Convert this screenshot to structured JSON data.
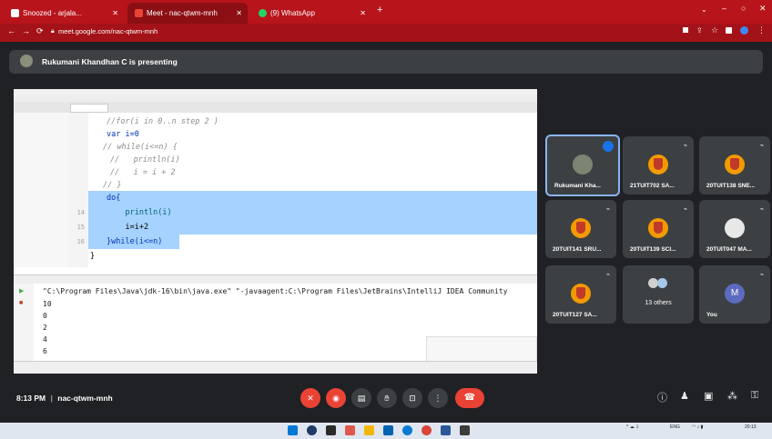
{
  "tabs": [
    {
      "label": "Snoozed - arjala...",
      "color": "#ffffff"
    },
    {
      "label": "Meet - nac-qtwm-mnh",
      "color": "#ea4335"
    },
    {
      "label": "(9) WhatsApp",
      "color": "#25d366"
    }
  ],
  "address": {
    "url": "meet.google.com/nac-qtwm-mnh"
  },
  "presenting": {
    "text": "Rukumani Khandhan C is presenting"
  },
  "code": {
    "lines": [
      {
        "num": "",
        "text": "//for(i in 0..n step 2 )",
        "style": "cmt",
        "selected": false
      },
      {
        "num": "",
        "text": "var i=0",
        "style": "kw",
        "selected": false
      },
      {
        "num": "",
        "text": "// while(i<=n) {",
        "style": "cmt",
        "selected": false
      },
      {
        "num": "",
        "text": "//   println(i)",
        "style": "cmt",
        "selected": false
      },
      {
        "num": "",
        "text": "//   i = i + 2",
        "style": "cmt",
        "selected": false
      },
      {
        "num": "",
        "text": "// }",
        "style": "cmt",
        "selected": false
      },
      {
        "num": "",
        "text": "do{",
        "style": "kw",
        "selected": true
      },
      {
        "num": "14",
        "text": "    println(i)",
        "style": "fn",
        "selected": true
      },
      {
        "num": "15",
        "text": "    i=i+2",
        "style": "plain",
        "selected": true
      },
      {
        "num": "16",
        "text": "}while(i<=n)",
        "style": "kw",
        "selected": true
      },
      {
        "num": "",
        "text": "}",
        "style": "plain",
        "selected": false
      }
    ]
  },
  "console": {
    "lines": [
      "\"C:\\Program Files\\Java\\jdk-16\\bin\\java.exe\" \"-javaagent:C:\\Program Files\\JetBrains\\IntelliJ IDEA Community",
      "10",
      "0",
      "2",
      "4",
      "6"
    ]
  },
  "participants": [
    {
      "name": "Rukumani Kha...",
      "avatar": "photo",
      "speaking": true
    },
    {
      "name": "21TUIT702 SA...",
      "avatar": "shield",
      "speaking": false
    },
    {
      "name": "20TUIT138 SNE...",
      "avatar": "shield",
      "speaking": false
    },
    {
      "name": "20TUIT141 SRU...",
      "avatar": "shield",
      "speaking": false
    },
    {
      "name": "20TUIT139 SCI...",
      "avatar": "shield",
      "speaking": false
    },
    {
      "name": "20TUIT047 MA...",
      "avatar": "shield-dark",
      "speaking": false
    },
    {
      "name": "20TUIT127 SA...",
      "avatar": "shield",
      "speaking": false
    },
    {
      "name": "13 others",
      "avatar": "group",
      "speaking": false
    },
    {
      "name": "You",
      "avatar": "M",
      "speaking": false
    }
  ],
  "meeting": {
    "time": "8:13 PM",
    "separator": "|",
    "code": "nac-qtwm-mnh"
  },
  "taskbar": {
    "lang": "ENG",
    "time": "20:13"
  },
  "colors": {
    "tab_bar": "#b8141b",
    "meet_bg": "#202124",
    "selection": "#a6d2ff",
    "end_call": "#ea4335"
  }
}
